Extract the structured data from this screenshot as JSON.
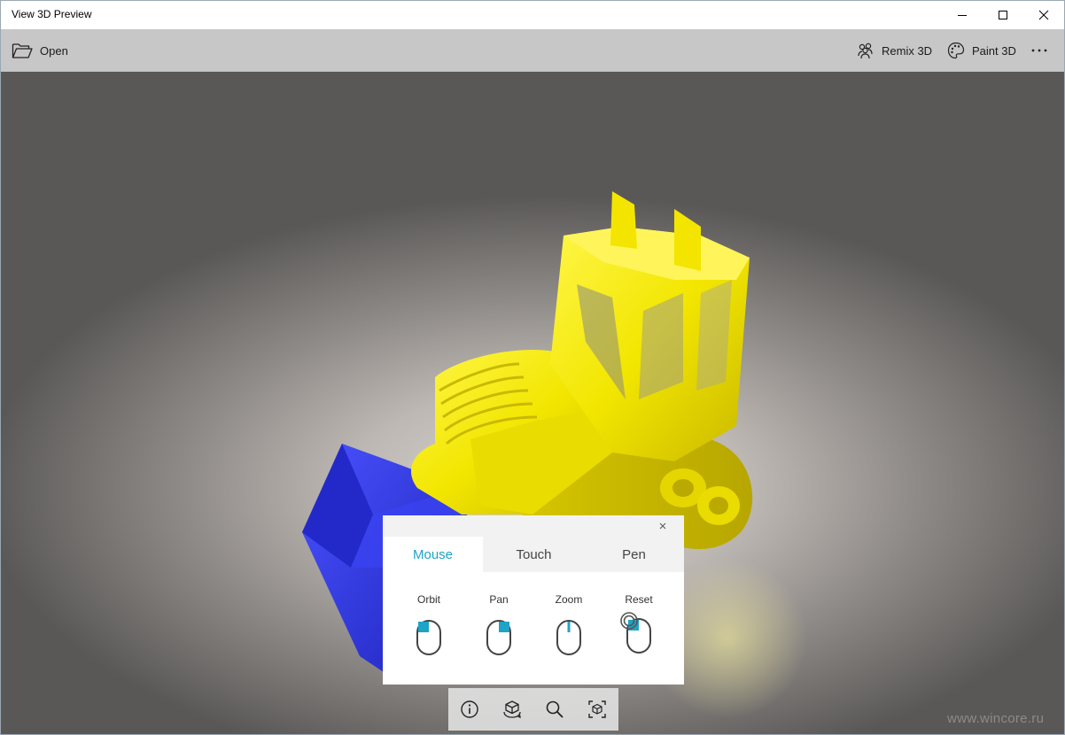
{
  "window": {
    "title": "View 3D Preview"
  },
  "command_bar": {
    "open_label": "Open",
    "remix_label": "Remix 3D",
    "paint_label": "Paint 3D"
  },
  "controls_panel": {
    "tabs": [
      {
        "label": "Mouse",
        "active": true
      },
      {
        "label": "Touch",
        "active": false
      },
      {
        "label": "Pen",
        "active": false
      }
    ],
    "actions": [
      {
        "label": "Orbit",
        "icon": "mouse-left-button-icon"
      },
      {
        "label": "Pan",
        "icon": "mouse-right-button-icon"
      },
      {
        "label": "Zoom",
        "icon": "mouse-scroll-wheel-icon"
      },
      {
        "label": "Reset",
        "icon": "mouse-double-click-icon"
      }
    ],
    "accent_color": "#1fa3c6"
  },
  "bottom_toolbar": {
    "icons": [
      "info-icon",
      "orbit-icon",
      "zoom-icon",
      "reset-view-icon"
    ]
  },
  "watermark": "www.wincore.ru",
  "colors": {
    "model_body": "#f0e400",
    "model_blade": "#2a32e0",
    "command_bar": "#c7c7c7"
  }
}
